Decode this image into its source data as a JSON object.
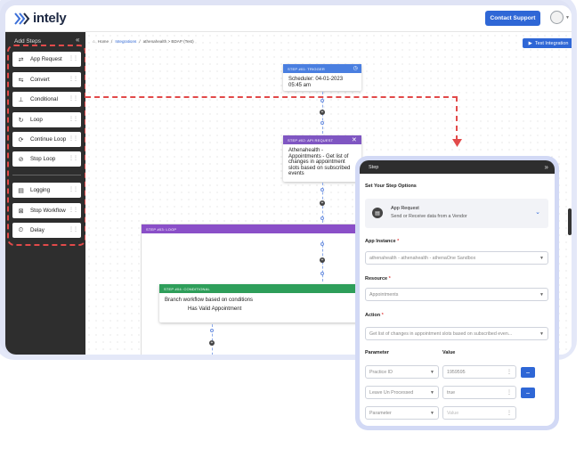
{
  "app": {
    "logo_text": "intely",
    "contact_label": "Contact Support",
    "colors": {
      "accent": "#2f67d6",
      "sidebar": "#2e2e2e",
      "dashed": "#e24a4a",
      "trigger": "#4a7fe0",
      "api": "#7f56c2",
      "loop": "#8a4fc8",
      "conditional": "#2e9e5a"
    }
  },
  "sidebar": {
    "title": "Add Steps",
    "collapse_icon": "double-chevron-left-icon",
    "items": [
      {
        "label": "App Request",
        "icon": "api-icon"
      },
      {
        "label": "Convert",
        "icon": "convert-icon"
      },
      {
        "label": "Conditional",
        "icon": "branch-icon"
      },
      {
        "label": "Loop",
        "icon": "loop-icon"
      },
      {
        "label": "Continue Loop",
        "icon": "continue-loop-icon"
      },
      {
        "label": "Stop Loop",
        "icon": "stop-loop-icon"
      },
      {
        "label": "Logging",
        "icon": "logging-icon"
      },
      {
        "label": "Stop Workflow",
        "icon": "stop-workflow-icon"
      },
      {
        "label": "Delay",
        "icon": "delay-icon"
      }
    ]
  },
  "breadcrumb": {
    "home": "Home",
    "sep1": "/",
    "integrations": "Integrations",
    "sep2": "/",
    "current": "athenahealth > BDAP (Test)"
  },
  "toolbar": {
    "test_label": "Test Integration"
  },
  "nodes": {
    "trigger": {
      "header": "STEP #01: TRIGGER",
      "body": "Scheduler: 04-01-2023 05:45 am"
    },
    "api": {
      "header": "STEP #02: API REQUEST",
      "body": "Athenahealth - Appointments - Get list of changes in appointment slots based on subscribed events"
    },
    "loop": {
      "header": "STEP #03: LOOP"
    },
    "conditional": {
      "header": "STEP #04: CONDITIONAL",
      "line1": "Branch workflow based on conditions",
      "line2": "Has Valid Appointment"
    }
  },
  "panel": {
    "title": "Step",
    "section": "Set Your Step Options",
    "step_type": {
      "title": "App Request",
      "subtitle": "Send or Receive data from a Vendor"
    },
    "app_instance": {
      "label": "App Instance",
      "value": "athenahealth - athenahealth - athenaOne Sandbox"
    },
    "resource": {
      "label": "Resource",
      "value": "Appointments"
    },
    "action": {
      "label": "Action",
      "value": "Get list of changes in appointment slots based on subscribed even..."
    },
    "params": {
      "param_header": "Parameter",
      "value_header": "Value",
      "rows": [
        {
          "param": "Practice ID",
          "value": "1959595"
        },
        {
          "param": "Leave Un Processed",
          "value": "true"
        },
        {
          "param": "Parameter",
          "value": "Value"
        }
      ]
    },
    "required_mark": "*"
  }
}
